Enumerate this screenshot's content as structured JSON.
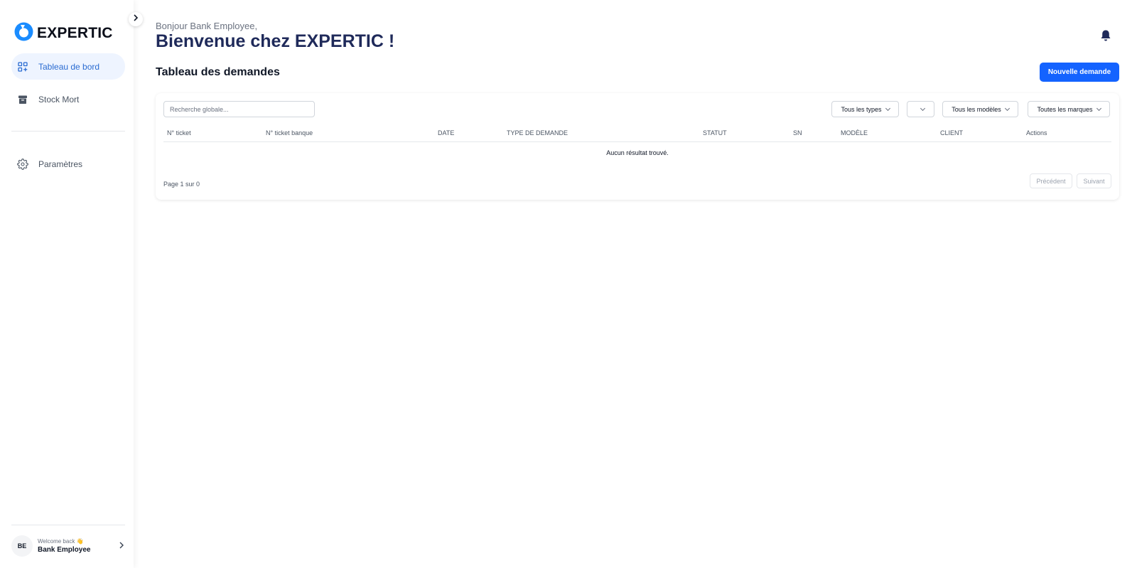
{
  "brand": {
    "name": "EXPERTIC",
    "accent": "#1463ff",
    "logo_color": "#1a8cff"
  },
  "sidebar": {
    "items": [
      {
        "label": "Tableau de bord",
        "icon": "dashboard-icon",
        "active": true
      },
      {
        "label": "Stock Mort",
        "icon": "archive-icon",
        "active": false
      },
      {
        "label": "Paramètres",
        "icon": "gear-icon",
        "active": false
      }
    ],
    "user": {
      "initials": "BE",
      "welcome": "Welcome back 👋",
      "name": "Bank Employee"
    }
  },
  "header": {
    "greeting": "Bonjour Bank Employee,",
    "title": "Bienvenue chez EXPERTIC !"
  },
  "section": {
    "title": "Tableau des demandes",
    "new_button": "Nouvelle demande"
  },
  "filters": {
    "search_placeholder": "Recherche globale...",
    "types": "Tous les types",
    "empty_select": "",
    "models": "Tous les modèles",
    "brands": "Toutes les marques"
  },
  "table": {
    "columns": [
      "N° ticket",
      "N° ticket banque",
      "DATE",
      "TYPE DE DEMANDE",
      "STATUT",
      "SN",
      "MODÈLE",
      "CLIENT",
      "Actions"
    ],
    "empty_message": "Aucun résultat trouvé."
  },
  "pagination": {
    "info": "Page 1 sur 0",
    "prev": "Précédent",
    "next": "Suivant"
  }
}
